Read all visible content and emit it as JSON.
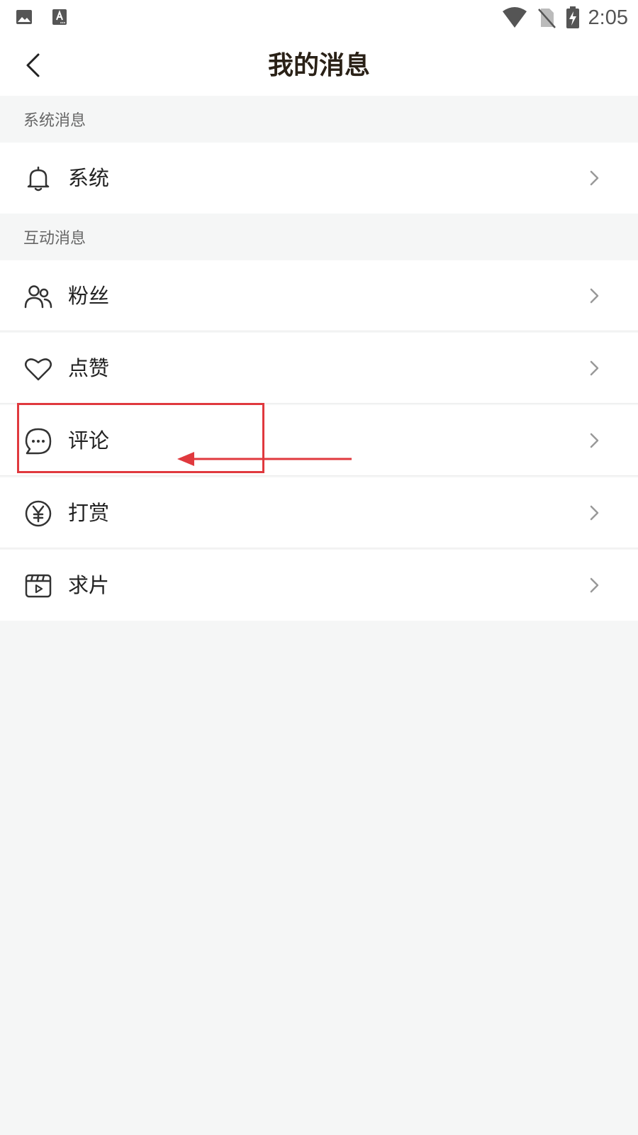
{
  "status_bar": {
    "left_icons": [
      "image-icon",
      "text-recognition-icon"
    ],
    "right_icons": [
      "wifi-icon",
      "no-sim-icon",
      "battery-charging-icon"
    ],
    "time": "2:05"
  },
  "header": {
    "title": "我的消息",
    "back_icon": "chevron-left-icon"
  },
  "sections": {
    "system": {
      "header": "系统消息",
      "items": [
        {
          "label": "系统",
          "icon": "bell-icon"
        }
      ]
    },
    "interaction": {
      "header": "互动消息",
      "items": [
        {
          "label": "粉丝",
          "icon": "users-icon"
        },
        {
          "label": "点赞",
          "icon": "heart-icon"
        },
        {
          "label": "评论",
          "icon": "comment-icon"
        },
        {
          "label": "打赏",
          "icon": "yen-coin-icon"
        },
        {
          "label": "求片",
          "icon": "video-request-icon"
        }
      ]
    }
  },
  "annotation": {
    "color": "#e0393e",
    "highlighted_item": "评论"
  }
}
